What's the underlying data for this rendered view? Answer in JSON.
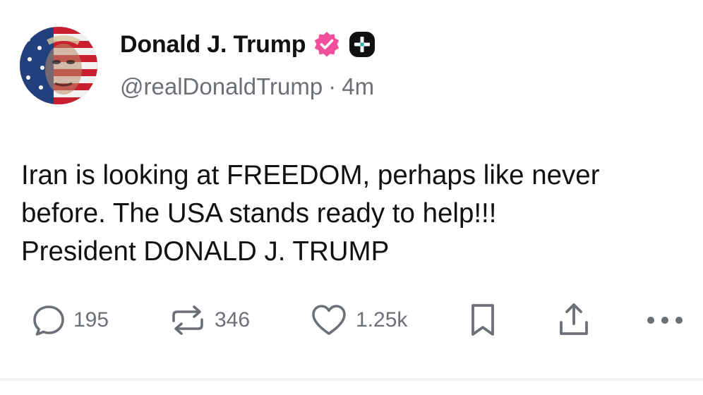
{
  "author": {
    "display_name": "Donald J. Trump",
    "handle": "@realDonaldTrump",
    "time_separator": "·",
    "timestamp": "4m",
    "verified_badge_color": "#f0509b",
    "plus_badge_color": "#111111"
  },
  "post": {
    "lines": [
      "Iran is looking at FREEDOM, perhaps like never",
      "before. The USA stands ready to help!!!",
      "President DONALD J. TRUMP"
    ]
  },
  "actions": {
    "reply": {
      "icon": "speech-bubble-icon",
      "count": "195"
    },
    "repost": {
      "icon": "repost-arrows-icon",
      "count": "346"
    },
    "like": {
      "icon": "heart-icon",
      "count": "1.25k"
    },
    "bookmark": {
      "icon": "bookmark-icon"
    },
    "share": {
      "icon": "share-upload-icon"
    },
    "more": {
      "icon": "more-dots-icon"
    },
    "icon_color": "#6b6f76"
  }
}
